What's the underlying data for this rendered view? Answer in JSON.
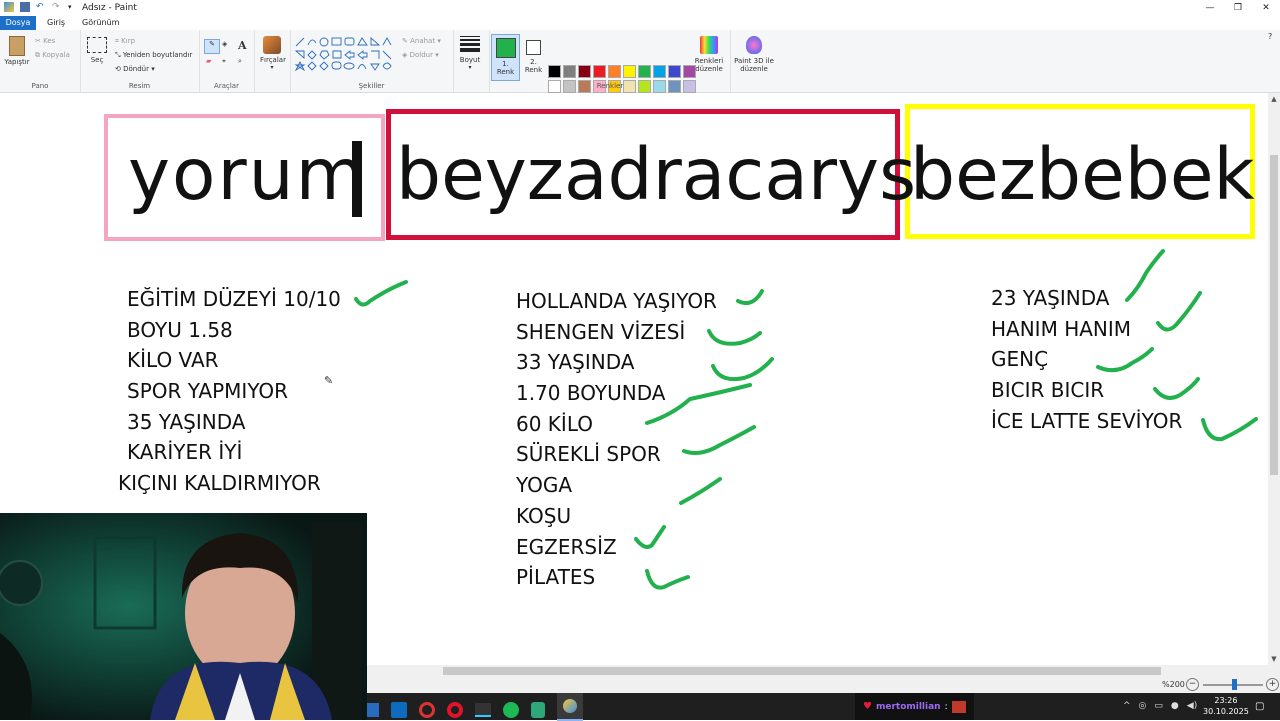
{
  "window": {
    "title": "Adsız - Paint"
  },
  "menu": {
    "file": "Dosya",
    "tabs": [
      "Giriş",
      "Görünüm"
    ]
  },
  "ribbon": {
    "clipboard": {
      "paste": "Yapıştır",
      "cut": "Kes",
      "copy": "Kopyala",
      "label": "Pano"
    },
    "image": {
      "select": "Seç",
      "crop": "Kırp",
      "resize": "Yeniden boyutlandır",
      "rotate": "Döndür",
      "label": "Resim"
    },
    "tools": {
      "label": "Araçlar"
    },
    "brushes": {
      "label": "Fırçalar"
    },
    "shapes": {
      "outline": "Anahat",
      "fill": "Doldur",
      "label": "Şekiller"
    },
    "size": {
      "label": "Boyut"
    },
    "color1": {
      "label": "1. Renk",
      "value": "#22b14c"
    },
    "color2": {
      "label": "2. Renk",
      "value": "#ffffff"
    },
    "edit_colors": "Renkleri düzenle",
    "paint3d": "Paint 3D ile düzenle",
    "colors_label": "Renkler",
    "palette": [
      "#000000",
      "#7f7f7f",
      "#880015",
      "#ed1c24",
      "#ff7f27",
      "#fff200",
      "#22b14c",
      "#00a2e8",
      "#3f48cc",
      "#a349a4",
      "#ffffff",
      "#c3c3c3",
      "#b97a57",
      "#ffaec9",
      "#ffc90e",
      "#efe4b0",
      "#b5e61d",
      "#99d9ea",
      "#7092be",
      "#c8bfe7"
    ]
  },
  "canvas": {
    "boxes": [
      {
        "word": "yorum",
        "border": "#f4a6c0"
      },
      {
        "word": "beyzadracarys",
        "border": "#d0103a"
      },
      {
        "word": "bezbebek",
        "border": "#ffff00"
      }
    ],
    "list_left": [
      "EĞİTİM DÜZEYİ 10/10",
      "BOYU 1.58",
      "KİLO VAR",
      "SPOR YAPMIYOR",
      "35 YAŞINDA",
      "KARİYER İYİ",
      "KIÇINI KALDIRMIYOR"
    ],
    "list_mid": [
      "HOLLANDA YAŞIYOR",
      "SHENGEN VİZESİ",
      "33 YAŞINDA",
      "1.70 BOYUNDA",
      "60 KİLO",
      "SÜREKLİ SPOR",
      "YOGA",
      "KOŞU",
      "EGZERSİZ",
      "PİLATES"
    ],
    "list_right": [
      "23 YAŞINDA",
      "HANIM HANIM",
      "GENÇ",
      "BICIR BICIR",
      "İCE LATTE SEVİYOR"
    ],
    "check_color": "#22b14c"
  },
  "status": {
    "zoom": "%200"
  },
  "taskbar": {
    "chat_user": "mertomillian",
    "time": "23:26",
    "date": "30.10.2025"
  }
}
